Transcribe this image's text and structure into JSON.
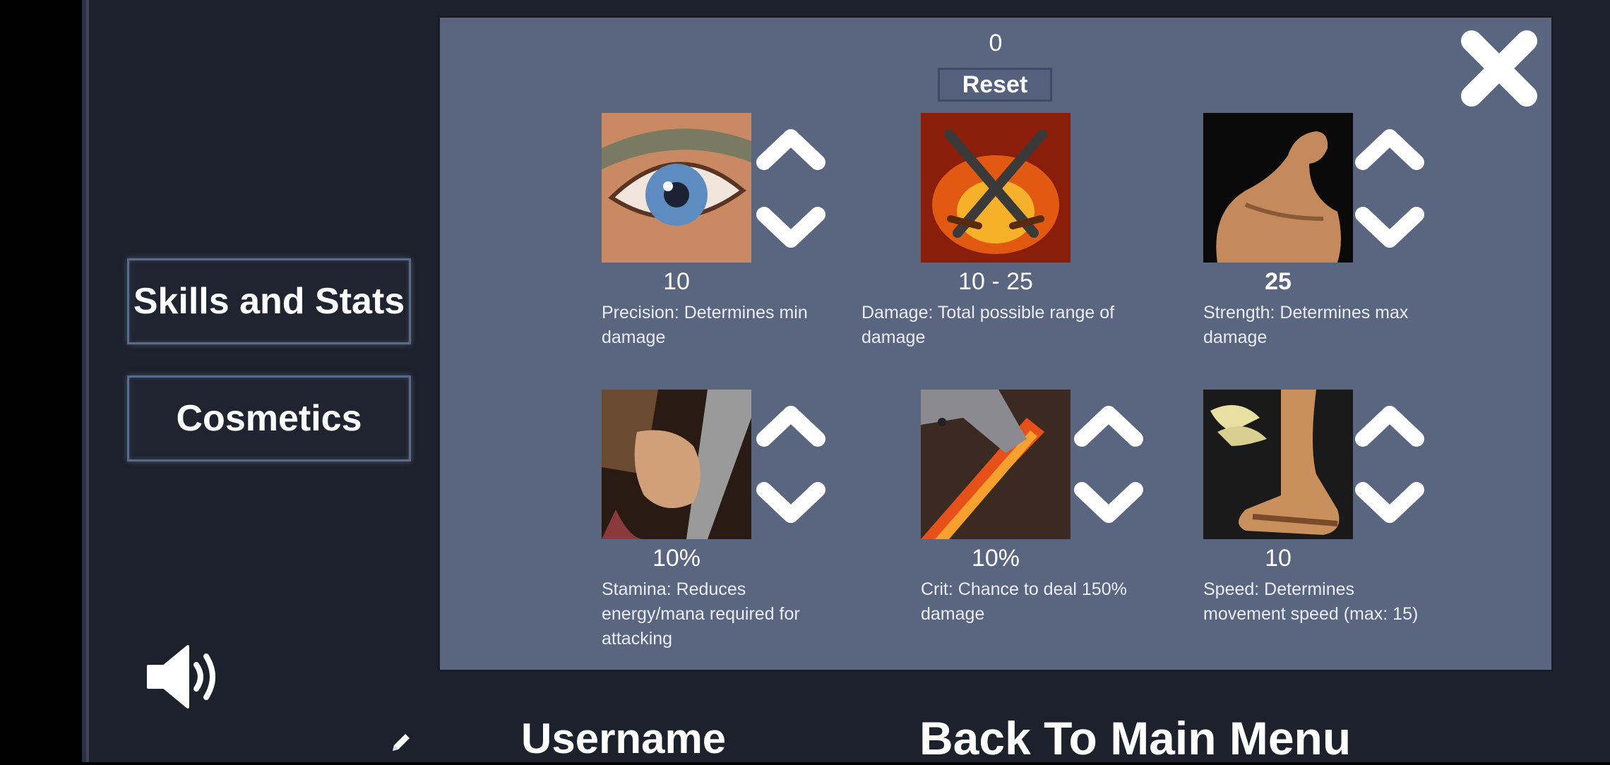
{
  "sidebar": {
    "skills_label": "Skills and Stats",
    "cosmetics_label": "Cosmetics"
  },
  "panel": {
    "points_available": "0",
    "reset_label": "Reset"
  },
  "stats": [
    {
      "name": "precision",
      "value": "10",
      "description": "Precision: Determines min damage"
    },
    {
      "name": "damage",
      "value": "10 - 25",
      "description": "Damage: Total possible range of damage"
    },
    {
      "name": "strength",
      "value": "25",
      "description": "Strength: Determines max damage"
    },
    {
      "name": "stamina",
      "value": "10%",
      "description": "Stamina: Reduces energy/mana required for attacking"
    },
    {
      "name": "crit",
      "value": "10%",
      "description": "Crit: Chance to deal 150% damage"
    },
    {
      "name": "speed",
      "value": "10",
      "description": "Speed: Determines movement speed (max: 15)"
    }
  ],
  "footer": {
    "username_label": "Username",
    "back_label": "Back To Main Menu"
  },
  "icons": [
    "speaker-icon",
    "pencil-icon",
    "close-icon",
    "arrow-up-icon",
    "arrow-down-icon"
  ]
}
